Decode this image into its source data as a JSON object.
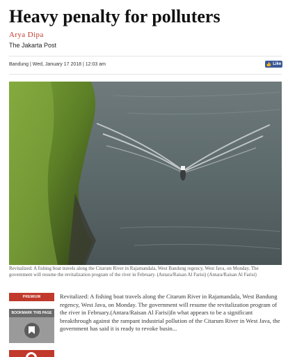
{
  "article": {
    "headline": "Heavy penalty for polluters",
    "author": "Arya Dipa",
    "outlet": "The Jakarta Post",
    "dateline": "Bandung | Wed, January 17 2018 | 12:03 am"
  },
  "share": {
    "fb_like_label": "Like",
    "fb_color": "#3b5998"
  },
  "photo": {
    "caption": "Revitalized: A fishing boat travels along the Citarum River in Rajamandala, West Bandung regency, West Java, on Monday. The government will resume the revitalization program of the river in February. (Antara/Raisan Al Farisi) (Antara/Raisan Al Farisi)"
  },
  "sidebar": {
    "premium_label": "PREMIUM",
    "bookmark_label": "BOOKMARK THIS PAGE",
    "bookmark_icon": "bookmark-icon",
    "accent_color": "#c0392b"
  },
  "body": {
    "text": "Revitalized: A fishing boat travels along the Citarum River in Rajamandala, West Bandung regency, West Java, on Monday. The government will resume the revitalization program of the river in February.(Antara/Raisan Al Farisi)In what appears to be a significant breakthrough against the rampant industrial pollution of the Citarum River in West Java, the government has said it is ready to revoke busin..."
  }
}
